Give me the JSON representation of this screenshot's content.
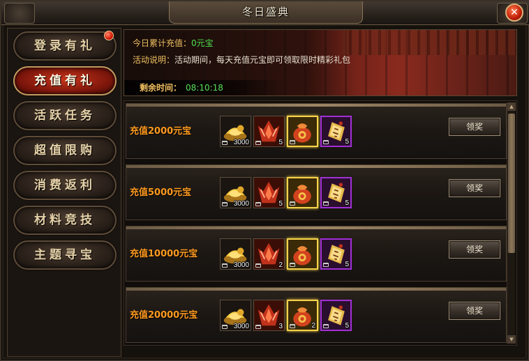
{
  "window": {
    "title": "冬日盛典",
    "close_symbol": "✕"
  },
  "sidebar": {
    "items": [
      {
        "label": "登录有礼",
        "active": false,
        "red_dot": true
      },
      {
        "label": "充值有礼",
        "active": true,
        "red_dot": false
      },
      {
        "label": "活跃任务",
        "active": false,
        "red_dot": false
      },
      {
        "label": "超值限购",
        "active": false,
        "red_dot": false
      },
      {
        "label": "消费返利",
        "active": false,
        "red_dot": false
      },
      {
        "label": "材料竞技",
        "active": false,
        "red_dot": false
      },
      {
        "label": "主题寻宝",
        "active": false,
        "red_dot": false
      }
    ]
  },
  "banner": {
    "recharge_label": "今日累计充值：",
    "recharge_value": "0元宝",
    "desc_label": "活动说明：",
    "desc_text": "活动期间，每天充值元宝即可领取限时精彩礼包",
    "remaining_label": "剩余时间：",
    "remaining_value": "08:10:18"
  },
  "rewards": [
    {
      "title": "充值2000元宝",
      "button": "领奖",
      "items": [
        {
          "icon": "gold-ingot-icon",
          "qty": "3000"
        },
        {
          "icon": "red-crystal-icon",
          "qty": "5"
        },
        {
          "icon": "red-pouch-icon",
          "qty": ""
        },
        {
          "icon": "talisman-icon",
          "qty": "5"
        }
      ]
    },
    {
      "title": "充值5000元宝",
      "button": "领奖",
      "items": [
        {
          "icon": "gold-ingot-icon",
          "qty": "3000"
        },
        {
          "icon": "red-crystal-icon",
          "qty": "5"
        },
        {
          "icon": "red-pouch-icon",
          "qty": ""
        },
        {
          "icon": "talisman-icon",
          "qty": "5"
        }
      ]
    },
    {
      "title": "充值10000元宝",
      "button": "领奖",
      "items": [
        {
          "icon": "gold-ingot-icon",
          "qty": "3000"
        },
        {
          "icon": "red-crystal-icon",
          "qty": "2"
        },
        {
          "icon": "red-pouch-icon",
          "qty": ""
        },
        {
          "icon": "talisman-icon",
          "qty": "5"
        }
      ]
    },
    {
      "title": "充值20000元宝",
      "button": "领奖",
      "items": [
        {
          "icon": "gold-ingot-icon",
          "qty": "3000"
        },
        {
          "icon": "red-crystal-icon",
          "qty": "3"
        },
        {
          "icon": "red-pouch-icon",
          "qty": "2"
        },
        {
          "icon": "talisman-icon",
          "qty": "5"
        }
      ]
    }
  ],
  "scrollbar": {
    "up_symbol": "▲",
    "down_symbol": "▼"
  },
  "colors": {
    "active_tab": "#b02a14",
    "reward_title": "#ff9a1e",
    "timer_value": "#55e055",
    "info_label": "#f0c060",
    "gold_frame": "#f6d34a",
    "purple_frame": "#a12fd6"
  }
}
